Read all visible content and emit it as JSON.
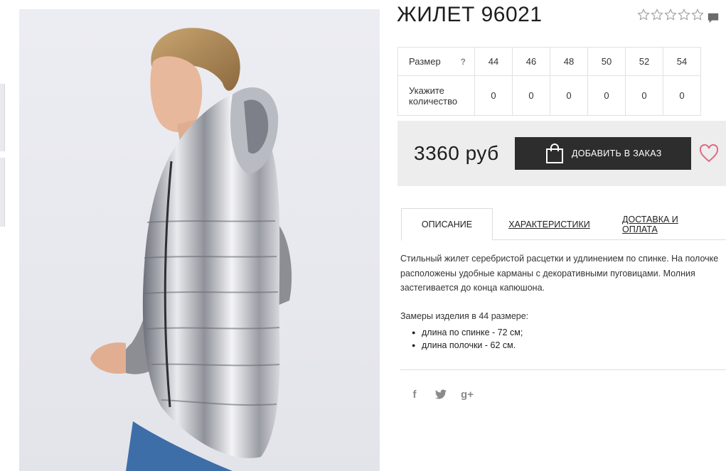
{
  "product": {
    "title": "ЖИЛЕТ 96021",
    "rating_stars": 5,
    "rating_value": 0,
    "photo_alt": "Серебристый жилет"
  },
  "sizes": {
    "size_label": "Размер",
    "help_mark": "?",
    "size_values": [
      "44",
      "46",
      "48",
      "50",
      "52",
      "54"
    ],
    "qty_label": "Укажите количество",
    "qty_values": [
      "0",
      "0",
      "0",
      "0",
      "0",
      "0"
    ]
  },
  "buy": {
    "price": "3360 руб",
    "add_label": "ДОБАВИТЬ В ЗАКАЗ"
  },
  "tabs": [
    {
      "label": "ОПИСАНИЕ"
    },
    {
      "label": "ХАРАКТЕРИСТИКИ"
    },
    {
      "label": "ДОСТАВКА И ОПЛАТА"
    }
  ],
  "description": {
    "text": "Стильный жилет серебристой расцетки и удлинением по спинке. На полочке расположены удобные карманы с декоративными пуговицами. Молния застегивается до конца капюшона.",
    "measures_title": "Замеры изделия в 44 размере:",
    "measures": [
      "длина по спинке - 72 см;",
      "длина полочки - 62 см."
    ]
  },
  "social": {
    "facebook": "f",
    "twitter": "twitter-icon",
    "googleplus": "g+"
  },
  "colors": {
    "button_bg": "#2d2d2d",
    "heart": "#e06b85",
    "buybox_bg": "#ededed"
  }
}
